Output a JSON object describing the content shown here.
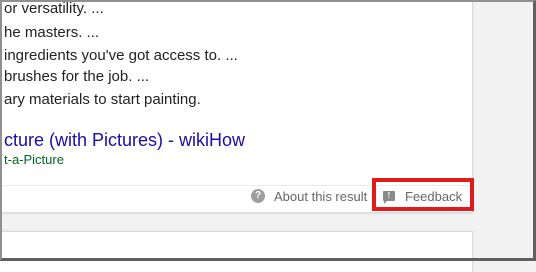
{
  "result": {
    "snippet_lines": [
      "or versatility. ...",
      "he masters. ...",
      "ingredients you've got access to. ...",
      "brushes for the job. ...",
      "ary materials to start painting."
    ],
    "title": "cture (with Pictures) - wikiHow",
    "url": "t-a-Picture"
  },
  "footer": {
    "about_label": "About this result",
    "feedback_label": "Feedback",
    "help_glyph": "?",
    "feedback_glyph": "!"
  },
  "icons": {
    "help": "question-circle-icon",
    "feedback": "feedback-flag-icon"
  },
  "colors": {
    "link": "#1a0dab",
    "url": "#006621",
    "highlight": "#e01b1b"
  }
}
